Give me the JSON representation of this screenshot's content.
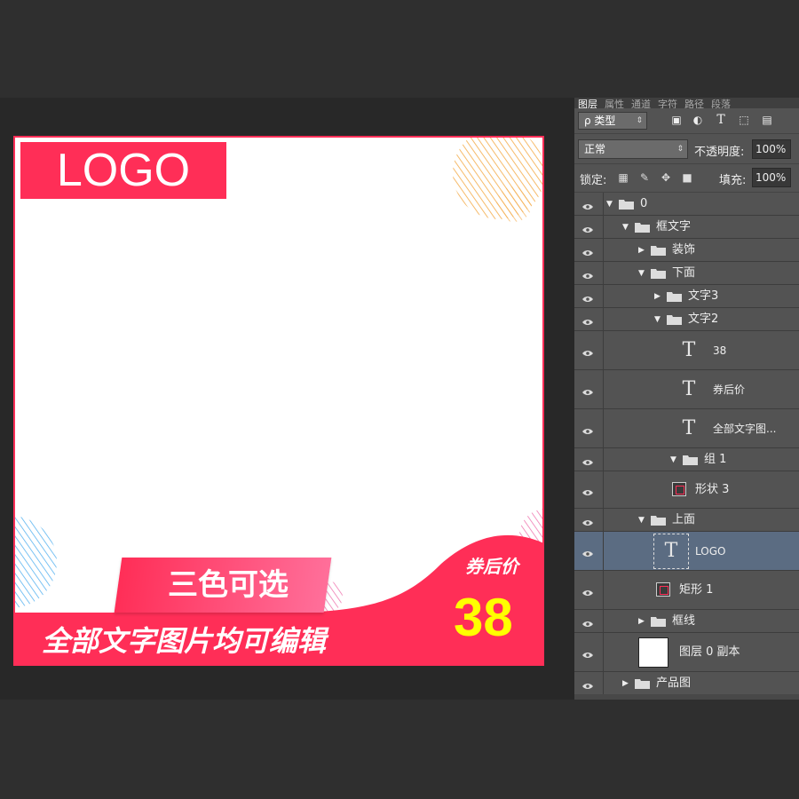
{
  "canvas": {
    "logo_text": "LOGO",
    "tag_text": "三色可选",
    "bottom_text": "全部文字图片均可编辑",
    "coupon_label": "券后价",
    "price": "38",
    "colors": {
      "accent": "#ff2e57",
      "price": "#ffff00",
      "deco_orange": "#f5b35a",
      "deco_blue": "#5ab4f0",
      "deco_pink": "#f07ab2"
    }
  },
  "panel": {
    "tabs": [
      "图层",
      "属性",
      "通道",
      "字符",
      "路径",
      "段落"
    ],
    "filter_label": "ρ 类型",
    "filter_icons": [
      "image-filter-icon",
      "adjustment-filter-icon",
      "type-filter-icon",
      "shape-filter-icon",
      "smart-object-filter-icon"
    ],
    "blend_mode": "正常",
    "opacity_label": "不透明度:",
    "opacity_value": "100%",
    "lock_label": "锁定:",
    "fill_label": "填充:",
    "fill_value": "100%",
    "layers": [
      {
        "name": "0",
        "kind": "group",
        "expanded": true
      },
      {
        "name": "框文字",
        "kind": "group",
        "expanded": true
      },
      {
        "name": "装饰",
        "kind": "group",
        "expanded": false
      },
      {
        "name": "下面",
        "kind": "group",
        "expanded": true
      },
      {
        "name": "文字3",
        "kind": "group",
        "expanded": false
      },
      {
        "name": "文字2",
        "kind": "group",
        "expanded": true
      },
      {
        "name": "38",
        "kind": "text"
      },
      {
        "name": "券后价",
        "kind": "text"
      },
      {
        "name": "全部文字图...",
        "kind": "text"
      },
      {
        "name": "组 1",
        "kind": "group",
        "expanded": true
      },
      {
        "name": "形状 3",
        "kind": "shape"
      },
      {
        "name": "上面",
        "kind": "group",
        "expanded": true
      },
      {
        "name": "LOGO",
        "kind": "text",
        "selected": true
      },
      {
        "name": "矩形 1",
        "kind": "shape"
      },
      {
        "name": "框线",
        "kind": "group",
        "expanded": false
      },
      {
        "name": "图层 0 副本",
        "kind": "pixel"
      },
      {
        "name": "产品图",
        "kind": "group",
        "expanded": false
      }
    ]
  }
}
